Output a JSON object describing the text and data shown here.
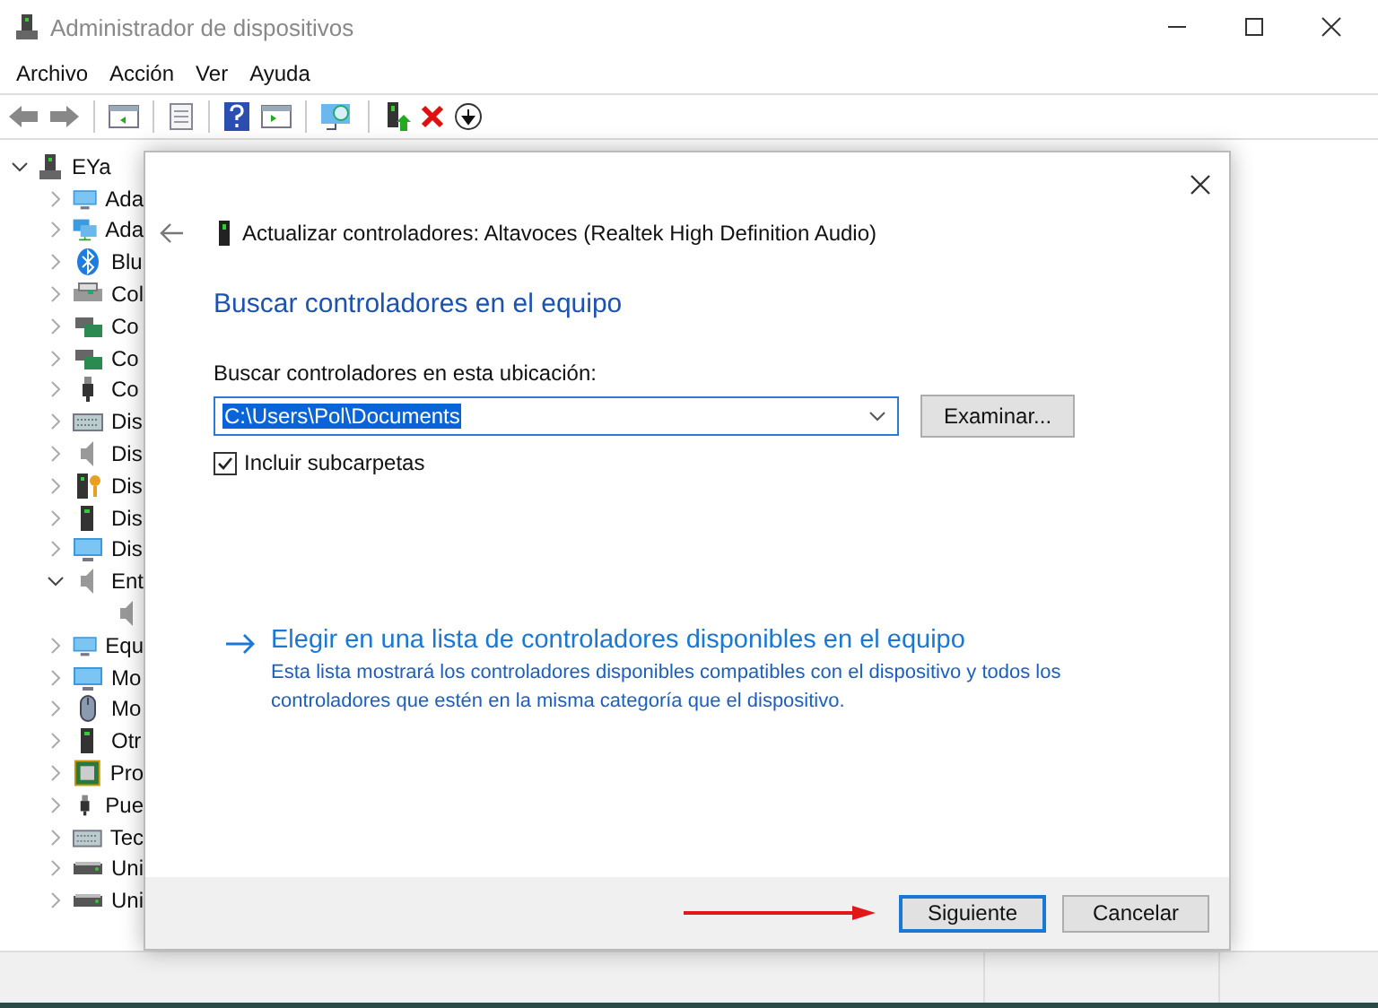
{
  "window": {
    "title": "Administrador de dispositivos"
  },
  "menu": [
    "Archivo",
    "Acción",
    "Ver",
    "Ayuda"
  ],
  "tree": {
    "label": "EYa",
    "expanded": true,
    "children": [
      {
        "label": "Ada",
        "expanded": false
      },
      {
        "label": "Ada",
        "expanded": false
      },
      {
        "label": "Blu",
        "expanded": false
      },
      {
        "label": "Col",
        "expanded": false
      },
      {
        "label": "Co",
        "expanded": false
      },
      {
        "label": "Co",
        "expanded": false
      },
      {
        "label": "Co",
        "expanded": false
      },
      {
        "label": "Dis",
        "expanded": false
      },
      {
        "label": "Dis",
        "expanded": false
      },
      {
        "label": "Dis",
        "expanded": false
      },
      {
        "label": "Dis",
        "expanded": false
      },
      {
        "label": "Dis",
        "expanded": false
      },
      {
        "label": "Ent",
        "expanded": true,
        "children": [
          {
            "kind": "device"
          }
        ]
      },
      {
        "label": "Equ",
        "expanded": false
      },
      {
        "label": "Mo",
        "expanded": false
      },
      {
        "label": "Mo",
        "expanded": false
      },
      {
        "label": "Otr",
        "expanded": false
      },
      {
        "label": "Pro",
        "expanded": false
      },
      {
        "label": "Pue",
        "expanded": false
      },
      {
        "label": "Tec",
        "expanded": false
      },
      {
        "label": "Uni",
        "expanded": false
      },
      {
        "label": "Uni",
        "expanded": false
      }
    ]
  },
  "dialog": {
    "title": "Actualizar controladores: Altavoces (Realtek High Definition Audio)",
    "heading": "Buscar controladores en el equipo",
    "location_label": "Buscar controladores en esta ubicación:",
    "path_field": {
      "value": "C:\\Users\\Pol\\Documents",
      "selected": true
    },
    "browse_button": "Examinar...",
    "include_subfolders": {
      "label": "Incluir subcarpetas",
      "checked": true
    },
    "link": "Elegir en una lista de controladores disponibles en el equipo",
    "description": "Esta lista mostrará los controladores disponibles compatibles con el dispositivo y todos los controladores que estén en la misma categoría que el dispositivo.",
    "buttons": [
      {
        "label": "Siguiente",
        "default": true
      },
      {
        "label": "Cancelar",
        "default": false
      }
    ]
  }
}
